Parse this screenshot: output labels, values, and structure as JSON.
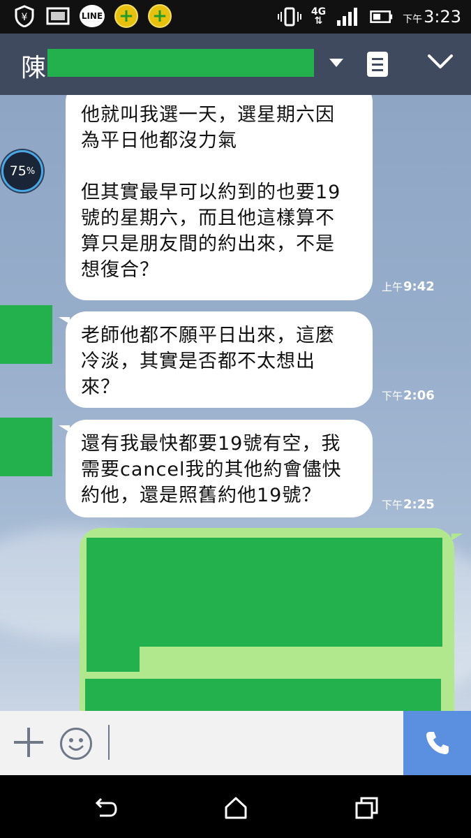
{
  "status_bar": {
    "line_label": "LINE",
    "network": "4G",
    "time_prefix": "下午",
    "time": "3:23"
  },
  "header": {
    "contact_name": "陳",
    "icons": [
      "chevron-down-icon",
      "notes-icon",
      "collapse-icon"
    ]
  },
  "widget": {
    "battery_value": "75",
    "battery_unit": "%"
  },
  "messages": [
    {
      "side": "incoming",
      "paragraphs": [
        "他就叫我選一天，選星期六因\n為平日他都沒力氣",
        "但其實最早可以約到的也要19\n號的星期六，而且他這樣算不\n算只是朋友間的約出來，不是\n想復合？"
      ],
      "time_prefix": "上午",
      "time": "9:42"
    },
    {
      "side": "incoming",
      "text": "老師他都不願平日出來，這麼\n冷淡，其實是否都不太想出\n來？",
      "time_prefix": "下午",
      "time": "2:06"
    },
    {
      "side": "incoming",
      "text": "還有我最快都要19號有空，我\n需要cancel我的其他約會儘快\n約他，還是照舊約他19號？",
      "time_prefix": "下午",
      "time": "2:25"
    }
  ],
  "colors": {
    "header_bg": "#3f4a5e",
    "outgoing_bubble": "#b1e88d",
    "redaction": "#22b14c",
    "call_button": "#5b8fe0"
  }
}
